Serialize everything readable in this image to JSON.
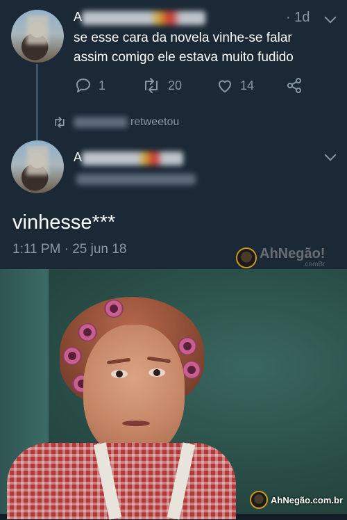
{
  "reply_tweet": {
    "name_prefix": "A",
    "time": "· 1d",
    "text_line1": "se esse cara da novela vinhe-se falar",
    "text_line2": "assim comigo ele estava muito fudido",
    "replies": "1",
    "retweets": "20",
    "likes": "14"
  },
  "retweet_context": {
    "label": "retweetou"
  },
  "main_tweet": {
    "name_prefix": "A",
    "text": "vinhesse***",
    "timestamp": "1:11 PM · 25 jun 18"
  },
  "watermarks": {
    "top_brand": "AhNegão!",
    "top_domain": ".comBr",
    "bottom": "AhNegão.com.br"
  },
  "colors": {
    "background": "#1b2836",
    "text": "#ffffff",
    "muted": "#8899a6"
  },
  "icons": [
    "reply-icon",
    "retweet-icon",
    "like-icon",
    "share-icon",
    "chevron-down-icon"
  ]
}
